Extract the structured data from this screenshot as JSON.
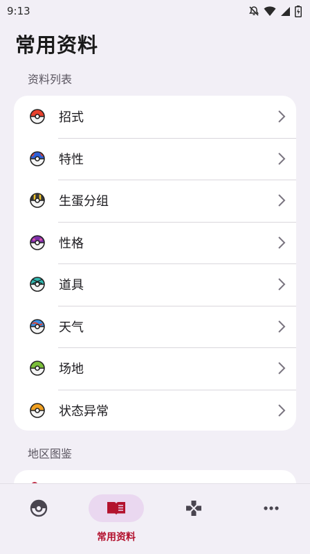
{
  "status_bar": {
    "time": "9:13",
    "icons": [
      "notifications-off-icon",
      "wifi-icon",
      "signal-icon",
      "battery-charging-icon"
    ]
  },
  "page": {
    "title": "常用资料"
  },
  "sections": [
    {
      "label": "资料列表",
      "items": [
        {
          "label": "招式",
          "icon": "poke-ball-icon"
        },
        {
          "label": "特性",
          "icon": "great-ball-icon"
        },
        {
          "label": "生蛋分组",
          "icon": "ultra-ball-icon"
        },
        {
          "label": "性格",
          "icon": "master-ball-icon"
        },
        {
          "label": "道具",
          "icon": "net-ball-icon"
        },
        {
          "label": "天气",
          "icon": "dive-ball-icon"
        },
        {
          "label": "场地",
          "icon": "nest-ball-icon"
        },
        {
          "label": "状态异常",
          "icon": "repeat-ball-icon"
        }
      ]
    },
    {
      "label": "地区图鉴",
      "items": []
    }
  ],
  "bottom_nav": {
    "items": [
      {
        "icon": "pokeball-tab-icon",
        "label": ""
      },
      {
        "icon": "book-icon",
        "label": "常用资料",
        "active": true
      },
      {
        "icon": "gamepad-icon",
        "label": ""
      },
      {
        "icon": "more-horizontal-icon",
        "label": ""
      }
    ]
  },
  "colors": {
    "background": "#f2eff6",
    "card": "#ffffff",
    "accent": "#b3122e",
    "active_pill": "#ead8f0"
  }
}
